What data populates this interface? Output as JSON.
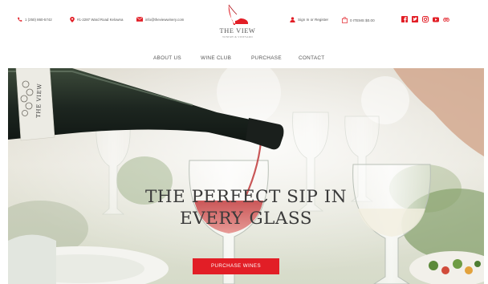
{
  "header": {
    "phone": "1 (250) 860-5742",
    "address": "#1-2287 Ward Road Kelowna",
    "email": "info@theviewwinery.com",
    "logo_title": "THE VIEW",
    "logo_subtitle": "WINERY & VINEYARD",
    "account_label": "Sign In or Register",
    "cart_label": "0 ITEMS $0.00",
    "socials": [
      "facebook-icon",
      "twitter-icon",
      "instagram-icon",
      "youtube-icon",
      "tripadvisor-icon"
    ]
  },
  "nav": {
    "items": [
      "ABOUT US",
      "WINE CLUB",
      "PURCHASE",
      "CONTACT"
    ]
  },
  "hero": {
    "title_line1": "THE PERFECT SIP IN",
    "title_line2": "EVERY GLASS",
    "button_label": "PURCHASE WINES",
    "bottle_label": "THE VIEW"
  },
  "colors": {
    "accent": "#e21e26",
    "text": "#555555"
  }
}
